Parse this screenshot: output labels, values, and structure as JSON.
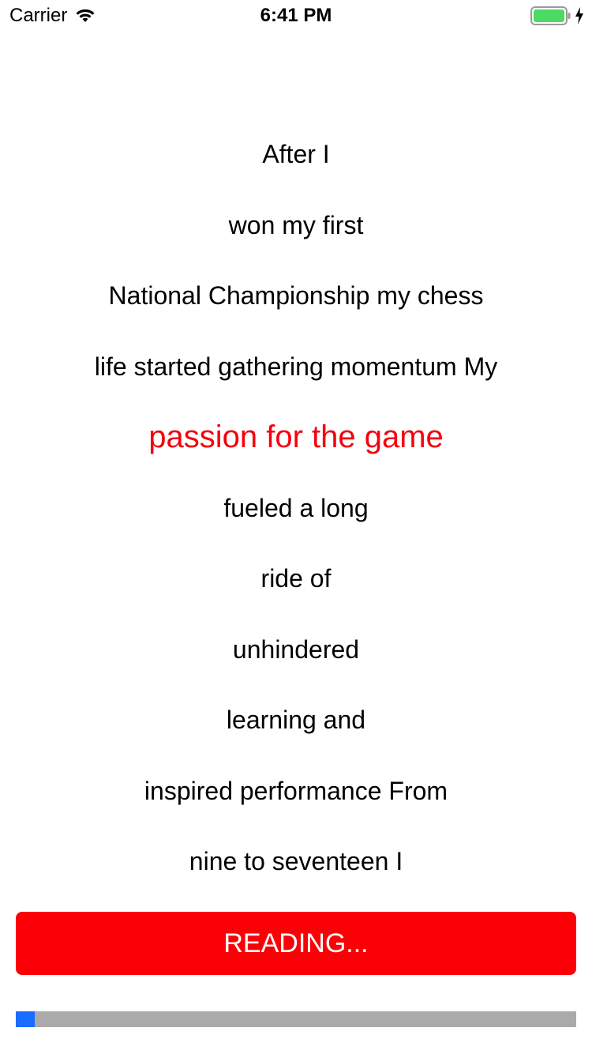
{
  "status_bar": {
    "carrier": "Carrier",
    "time": "6:41 PM",
    "battery_color": "#4cd964"
  },
  "reader": {
    "lines": [
      {
        "text": "After I",
        "highlighted": false
      },
      {
        "text": "won my first",
        "highlighted": false
      },
      {
        "text": "National Championship my chess",
        "highlighted": false
      },
      {
        "text": "life started gathering momentum My",
        "highlighted": false
      },
      {
        "text": "passion for the game",
        "highlighted": true
      },
      {
        "text": "fueled a long",
        "highlighted": false
      },
      {
        "text": "ride of",
        "highlighted": false
      },
      {
        "text": "unhindered",
        "highlighted": false
      },
      {
        "text": "learning and",
        "highlighted": false
      },
      {
        "text": "inspired performance From",
        "highlighted": false
      },
      {
        "text": "nine to seventeen I",
        "highlighted": false
      }
    ],
    "text_color": "#000000",
    "highlight_color": "#f5000f"
  },
  "reading_button": {
    "label": "READING...",
    "background": "#fb0007"
  },
  "progress": {
    "value": 0.034,
    "track_color": "#aaaaaa",
    "fill_color": "#1a6cff"
  }
}
